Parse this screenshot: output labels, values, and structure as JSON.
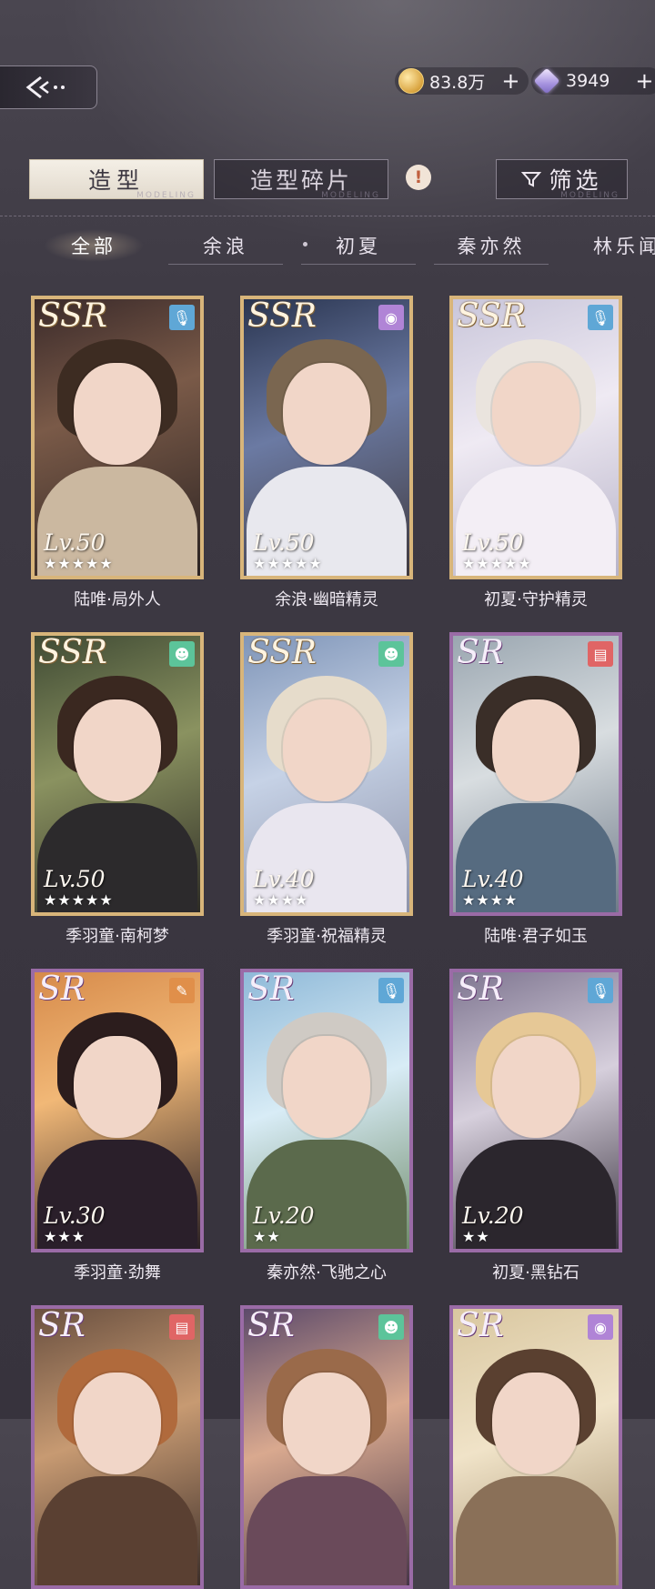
{
  "currency": {
    "gold": {
      "value": "83.8万",
      "plus": "+"
    },
    "gems": {
      "value": "3949",
      "plus": "+"
    }
  },
  "tabs": {
    "outfit": "造型",
    "shards": "造型碎片",
    "info_mark": "!",
    "filter": "筛选",
    "subtitle": "MODELING"
  },
  "characters": [
    "全部",
    "余浪",
    "初夏",
    "秦亦然",
    "林乐闻"
  ],
  "colors": {
    "ssr_border": "#d8b57a",
    "sr_border": "#9a6ba6",
    "tag_voice": "#5fa7d6",
    "tag_bubble": "#b084d6",
    "tag_smile": "#5cc49a",
    "tag_video": "#e06565",
    "tag_mic": "#e08f4a"
  },
  "cards": [
    {
      "name": "陆唯·局外人",
      "rarity": "SSR",
      "level": "Lv.50",
      "stars": "★★★★★",
      "tag": "mic-icon"
    },
    {
      "name": "余浪·幽暗精灵",
      "rarity": "SSR",
      "level": "Lv.50",
      "stars": "★★★★★",
      "tag": "record-icon"
    },
    {
      "name": "初夏·守护精灵",
      "rarity": "SSR",
      "level": "Lv.50",
      "stars": "★★★★★",
      "tag": "mic-icon"
    },
    {
      "name": "季羽童·南柯梦",
      "rarity": "SSR",
      "level": "Lv.50",
      "stars": "★★★★★",
      "tag": "smile-icon"
    },
    {
      "name": "季羽童·祝福精灵",
      "rarity": "SSR",
      "level": "Lv.40",
      "stars": "★★★★",
      "tag": "smile-icon"
    },
    {
      "name": "陆唯·君子如玉",
      "rarity": "SR",
      "level": "Lv.40",
      "stars": "★★★★",
      "tag": "clapper-icon"
    },
    {
      "name": "季羽童·劲舞",
      "rarity": "SR",
      "level": "Lv.30",
      "stars": "★★★",
      "tag": "karaoke-icon"
    },
    {
      "name": "秦亦然·飞驰之心",
      "rarity": "SR",
      "level": "Lv.20",
      "stars": "★★",
      "tag": "mic-icon"
    },
    {
      "name": "初夏·黑钻石",
      "rarity": "SR",
      "level": "Lv.20",
      "stars": "★★",
      "tag": "mic-icon"
    },
    {
      "name": "",
      "rarity": "SR",
      "level": "",
      "stars": "",
      "tag": "clapper-icon"
    },
    {
      "name": "",
      "rarity": "SR",
      "level": "",
      "stars": "",
      "tag": "smile-icon"
    },
    {
      "name": "",
      "rarity": "SR",
      "level": "",
      "stars": "",
      "tag": "record-icon"
    }
  ]
}
